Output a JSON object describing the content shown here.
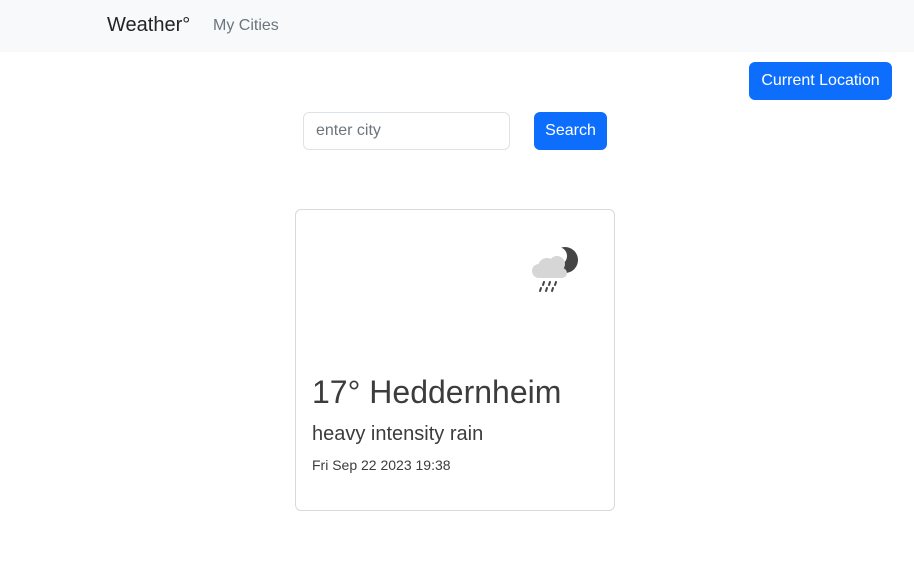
{
  "navbar": {
    "brand": "Weather°",
    "links": [
      {
        "label": "My Cities"
      }
    ]
  },
  "location_button": {
    "label": "Current Location"
  },
  "search": {
    "placeholder": "enter city",
    "value": "",
    "button_label": "Search"
  },
  "weather_card": {
    "icon": "rain-cloud-moon-icon",
    "title": "17° Heddernheim",
    "description": "heavy intensity rain",
    "timestamp": "Fri Sep 22 2023 19:38"
  },
  "colors": {
    "primary": "#0d6efd",
    "navbar_bg": "#f8f9fa",
    "muted_text": "#6c757d",
    "card_text": "#3c3c3c"
  }
}
